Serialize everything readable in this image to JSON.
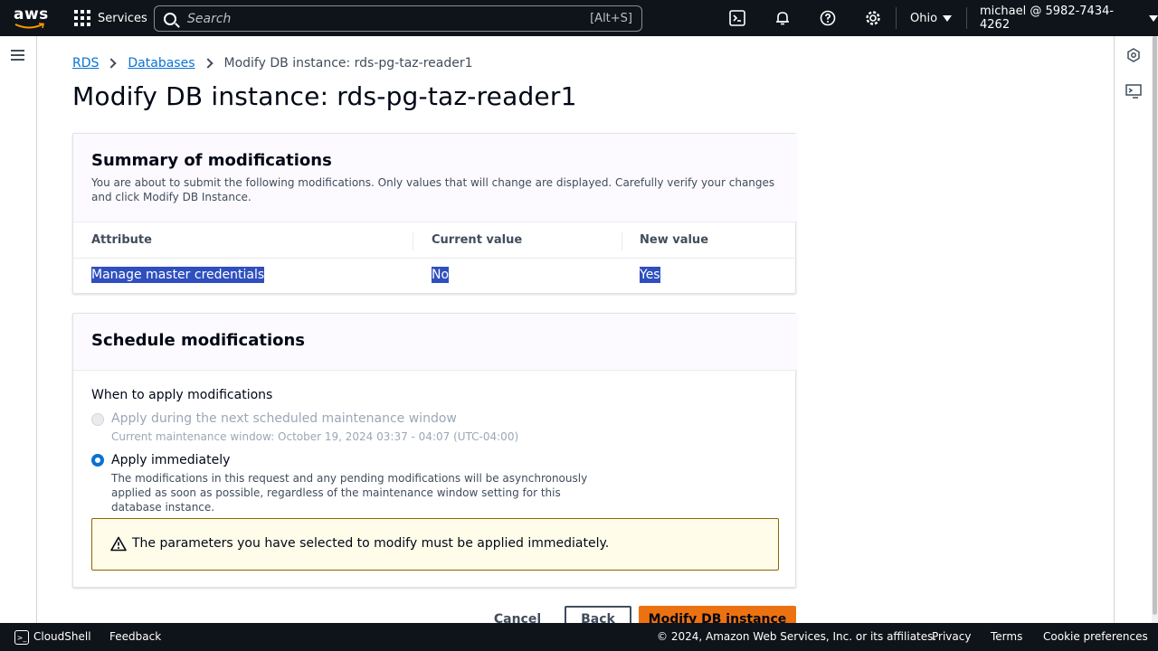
{
  "topnav": {
    "logo": "aws",
    "services_label": "Services",
    "search_placeholder": "Search",
    "search_shortcut": "[Alt+S]",
    "region": "Ohio",
    "account": "michael @ 5982-7434-4262",
    "icons": [
      "cloudshell-icon",
      "bell-icon",
      "help-icon",
      "gear-icon"
    ]
  },
  "breadcrumb": {
    "items": [
      "RDS",
      "Databases"
    ],
    "current": "Modify DB instance: rds-pg-taz-reader1"
  },
  "page": {
    "title": "Modify DB instance: rds-pg-taz-reader1"
  },
  "summary": {
    "title": "Summary of modifications",
    "description": "You are about to submit the following modifications. Only values that will change are displayed. Carefully verify your changes and click Modify DB Instance.",
    "columns": [
      "Attribute",
      "Current value",
      "New value"
    ],
    "rows": [
      {
        "attribute": "Manage master credentials",
        "current": "No",
        "new": "Yes"
      }
    ]
  },
  "schedule": {
    "title": "Schedule modifications",
    "label": "When to apply modifications",
    "options": [
      {
        "label": "Apply during the next scheduled maintenance window",
        "description": "Current maintenance window: October 19, 2024 03:37 - 04:07 (UTC-04:00)",
        "selected": false,
        "disabled": true
      },
      {
        "label": "Apply immediately",
        "description": "The modifications in this request and any pending modifications will be asynchronously applied as soon as possible, regardless of the maintenance window setting for this database instance.",
        "selected": true,
        "disabled": false
      }
    ],
    "alert": "The parameters you have selected to modify must be applied immediately."
  },
  "actions": {
    "cancel": "Cancel",
    "back": "Back",
    "submit": "Modify DB instance"
  },
  "footer": {
    "cloudshell": "CloudShell",
    "feedback": "Feedback",
    "copyright": "© 2024, Amazon Web Services, Inc. or its affiliates.",
    "privacy": "Privacy",
    "terms": "Terms",
    "cookies": "Cookie preferences"
  },
  "colors": {
    "nav_bg": "#0f141a",
    "link": "#0972d3",
    "primary": "#ec7211",
    "selection": "#2f4fbf",
    "alert_border": "#8d6605",
    "alert_bg": "#fffce9"
  }
}
